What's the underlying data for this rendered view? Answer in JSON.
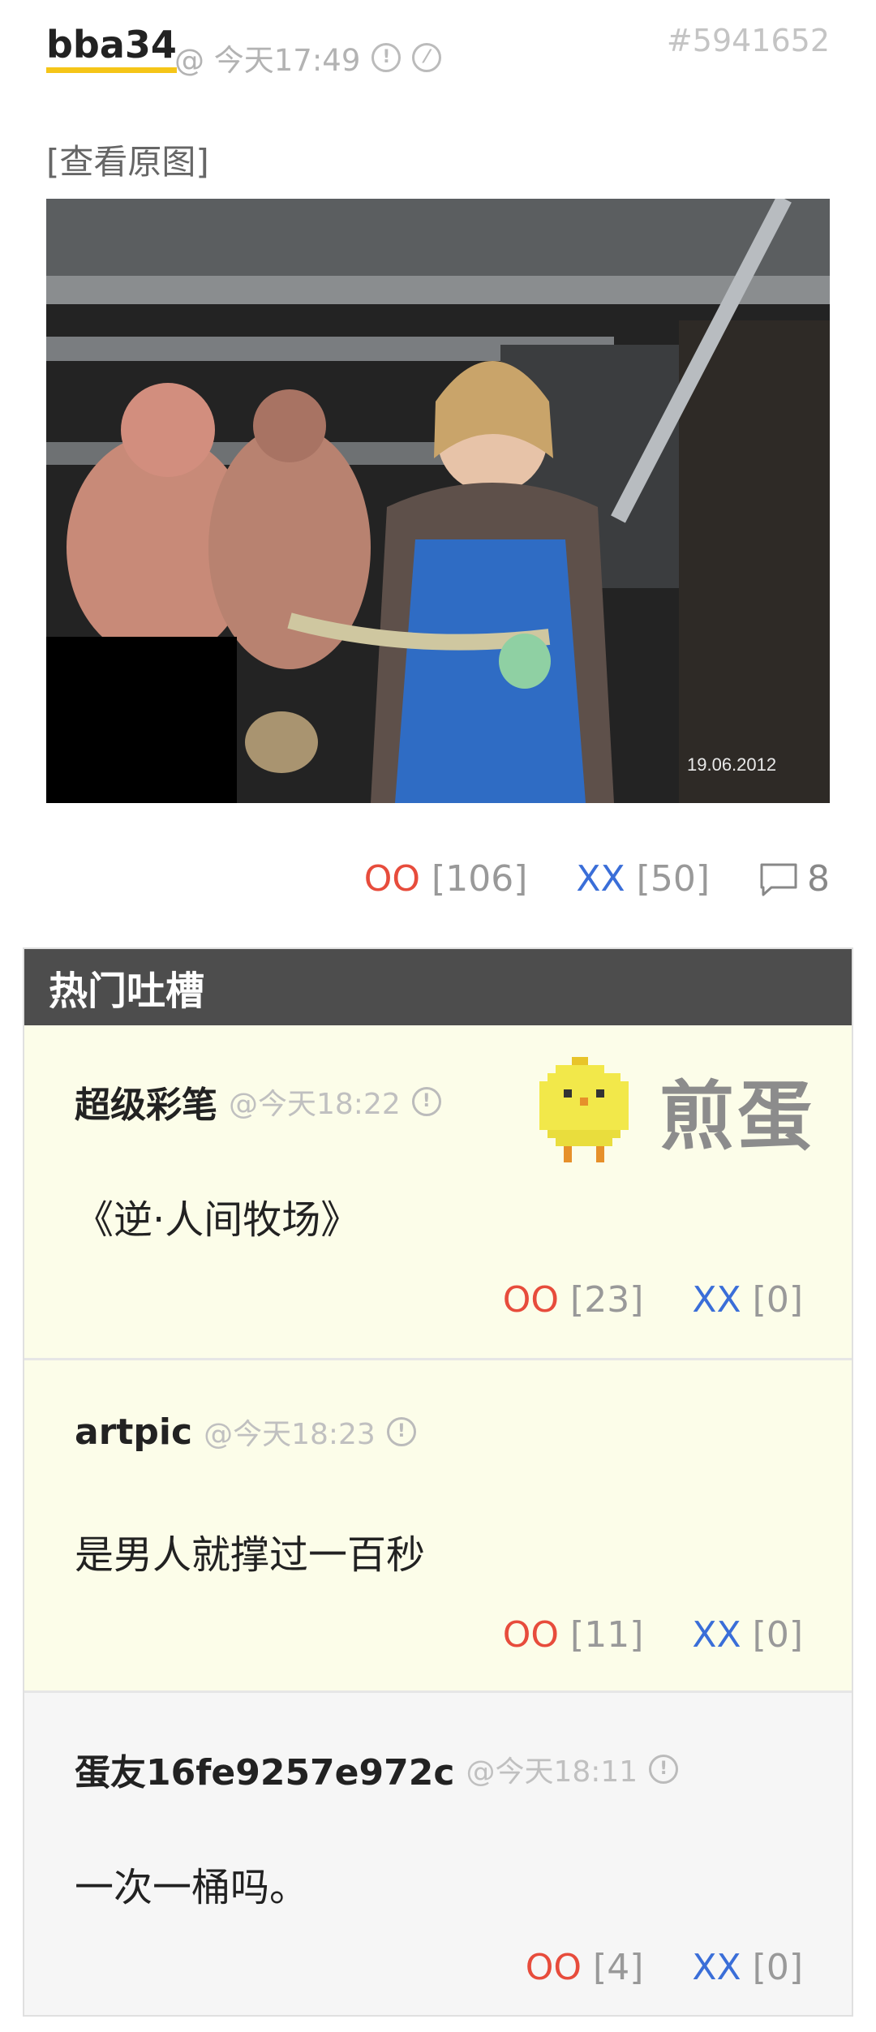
{
  "post": {
    "author": "bba34",
    "timestamp": "@ 今天17:49",
    "report_icon": "exclamation-circle-icon",
    "block_icon": "slash-circle-icon",
    "id": "#5941652",
    "view_original": "[查看原图]",
    "image_date": "19.06.2012",
    "oo_label": "OO",
    "oo_count": "[106]",
    "xx_label": "XX",
    "xx_count": "[50]",
    "comments_count": "8"
  },
  "hot": {
    "title": "热门吐槽",
    "logo_text": "煎蛋",
    "comments": [
      {
        "author": "超级彩笔",
        "time": "@今天18:22",
        "body": "《逆·人间牧场》",
        "oo": "OO",
        "oo_count": "[23]",
        "xx": "XX",
        "xx_count": "[0]"
      },
      {
        "author": "artpic",
        "time": "@今天18:23",
        "body": "是男人就撑过一百秒",
        "oo": "OO",
        "oo_count": "[11]",
        "xx": "XX",
        "xx_count": "[0]"
      },
      {
        "author": "蛋友16fe9257e972c",
        "time": "@今天18:11",
        "body": "一次一桶吗。",
        "oo": "OO",
        "oo_count": "[4]",
        "xx": "XX",
        "xx_count": "[0]"
      }
    ]
  },
  "colors": {
    "accent": "#f5c518",
    "oo": "#e74c3c",
    "xx": "#3a6ed8",
    "header": "#4d4d4d",
    "hot_bg": "#fcfde9"
  }
}
